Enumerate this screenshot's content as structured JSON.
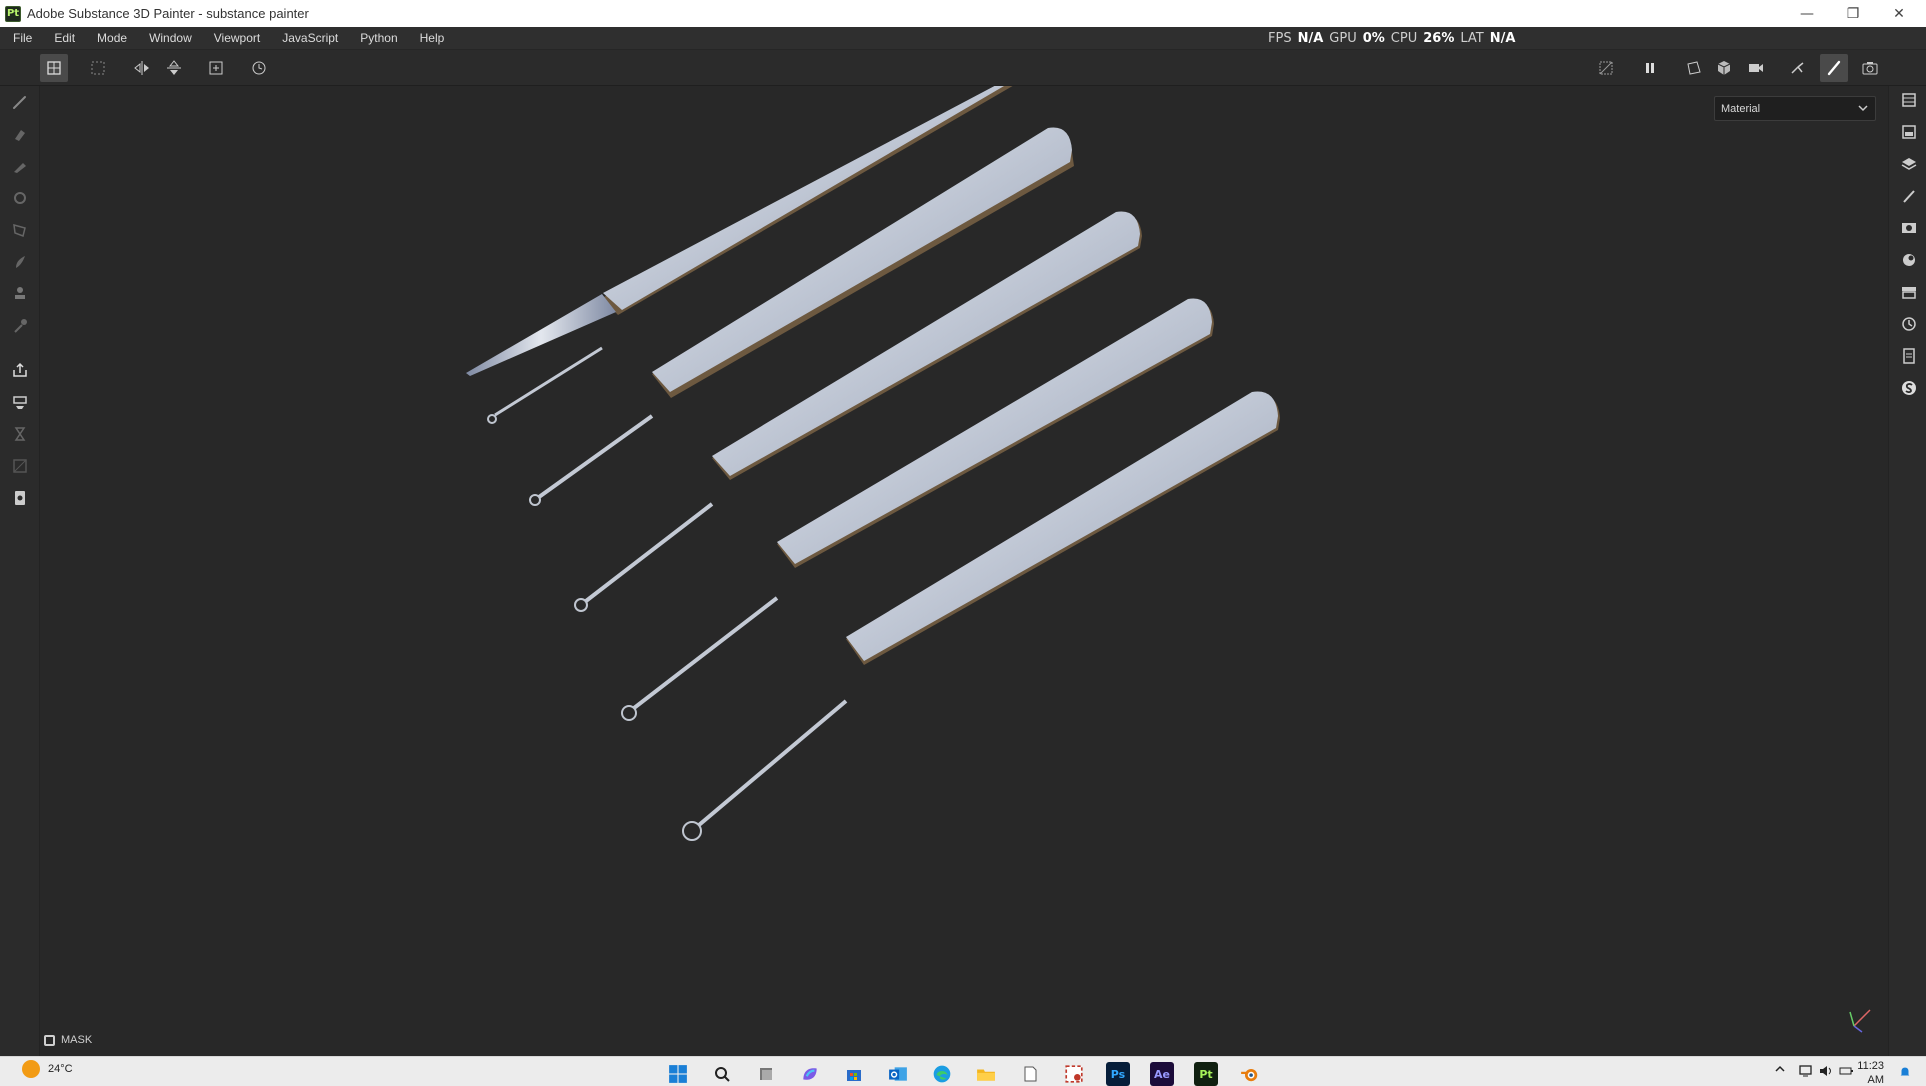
{
  "window": {
    "title": "Adobe Substance 3D Painter - substance painter",
    "logo_text": "Pt",
    "controls": {
      "minimize": "—",
      "restore": "❐",
      "close": "✕"
    }
  },
  "menu": {
    "items": [
      "File",
      "Edit",
      "Mode",
      "Window",
      "Viewport",
      "JavaScript",
      "Python",
      "Help"
    ]
  },
  "stats": {
    "fps_label": "FPS",
    "fps_value": "N/A",
    "gpu_label": "GPU",
    "gpu_value": "0%",
    "cpu_label": "CPU",
    "cpu_value": "26%",
    "lat_label": "LAT",
    "lat_value": "N/A"
  },
  "viewport": {
    "material_dropdown": "Material",
    "mask_label": "MASK"
  },
  "taskbar": {
    "weather_temp": "24°C",
    "time": "11:23 AM",
    "apps": [
      "windows-start",
      "search",
      "file-manager",
      "copilot",
      "store",
      "outlook",
      "edge",
      "file-explorer",
      "notepad",
      "snipping-tool",
      "photoshop",
      "after-effects",
      "substance-painter",
      "blender"
    ],
    "app_labels": {
      "photoshop": "Ps",
      "after_effects": "Ae",
      "substance_painter": "Pt"
    }
  }
}
